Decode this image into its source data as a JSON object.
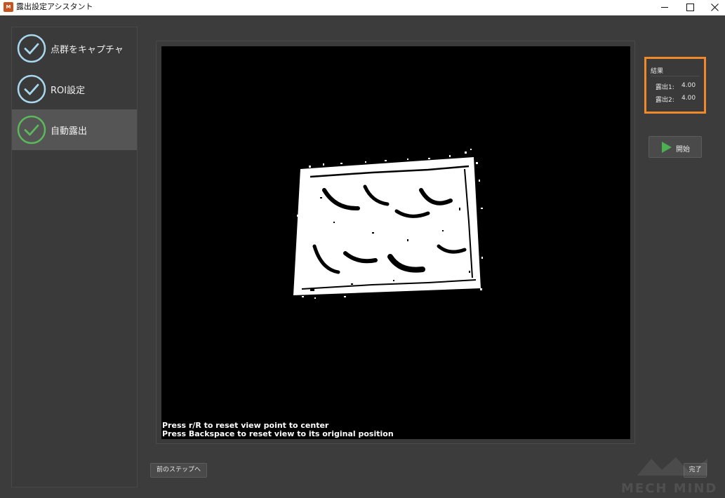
{
  "window": {
    "icon_text": "MECH",
    "title": "露出設定アシスタント"
  },
  "sidebar": {
    "steps": [
      {
        "label": "点群をキャプチャ",
        "icon": "check-circle-icon",
        "state": "done",
        "color": "#a9d8ee"
      },
      {
        "label": "ROI設定",
        "icon": "check-circle-icon",
        "state": "done",
        "color": "#a9d8ee"
      },
      {
        "label": "自動露出",
        "icon": "check-circle-icon",
        "state": "active",
        "color": "#5bb85b"
      }
    ]
  },
  "viewport": {
    "hint_line1": "Press r/R to reset view point to center",
    "hint_line2": "Press Backspace to reset view to its original position"
  },
  "results": {
    "title": "結果",
    "rows": [
      {
        "label": "露出1:",
        "value": "4.00"
      },
      {
        "label": "露出2:",
        "value": "4.00"
      }
    ],
    "highlight_color": "#f0892a"
  },
  "start_button": {
    "label": "開始",
    "icon": "play-icon",
    "icon_color": "#4caf50"
  },
  "footer": {
    "prev_label": "前のステップへ",
    "done_label": "完了"
  },
  "watermark": {
    "text": "MECH MIND"
  }
}
